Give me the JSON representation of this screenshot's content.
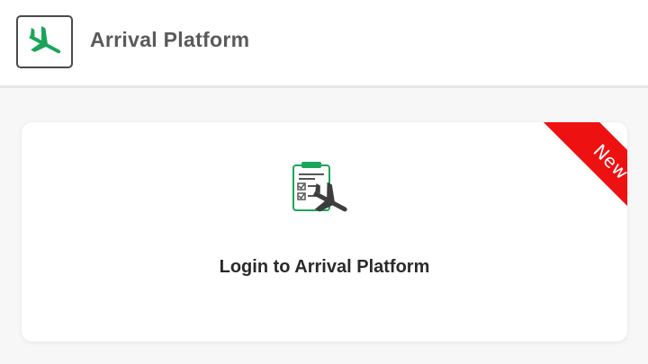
{
  "header": {
    "title": "Arrival Platform",
    "logo_icon": "airplane-landing-icon"
  },
  "card": {
    "label": "Login to Arrival Platform",
    "icon": "checklist-airplane-icon",
    "ribbon_text": "New",
    "ribbon_color": "#ee1111"
  },
  "colors": {
    "brand_green": "#1aa55a",
    "text_dark": "#2a2a2a",
    "text_header": "#5a5a5a"
  }
}
